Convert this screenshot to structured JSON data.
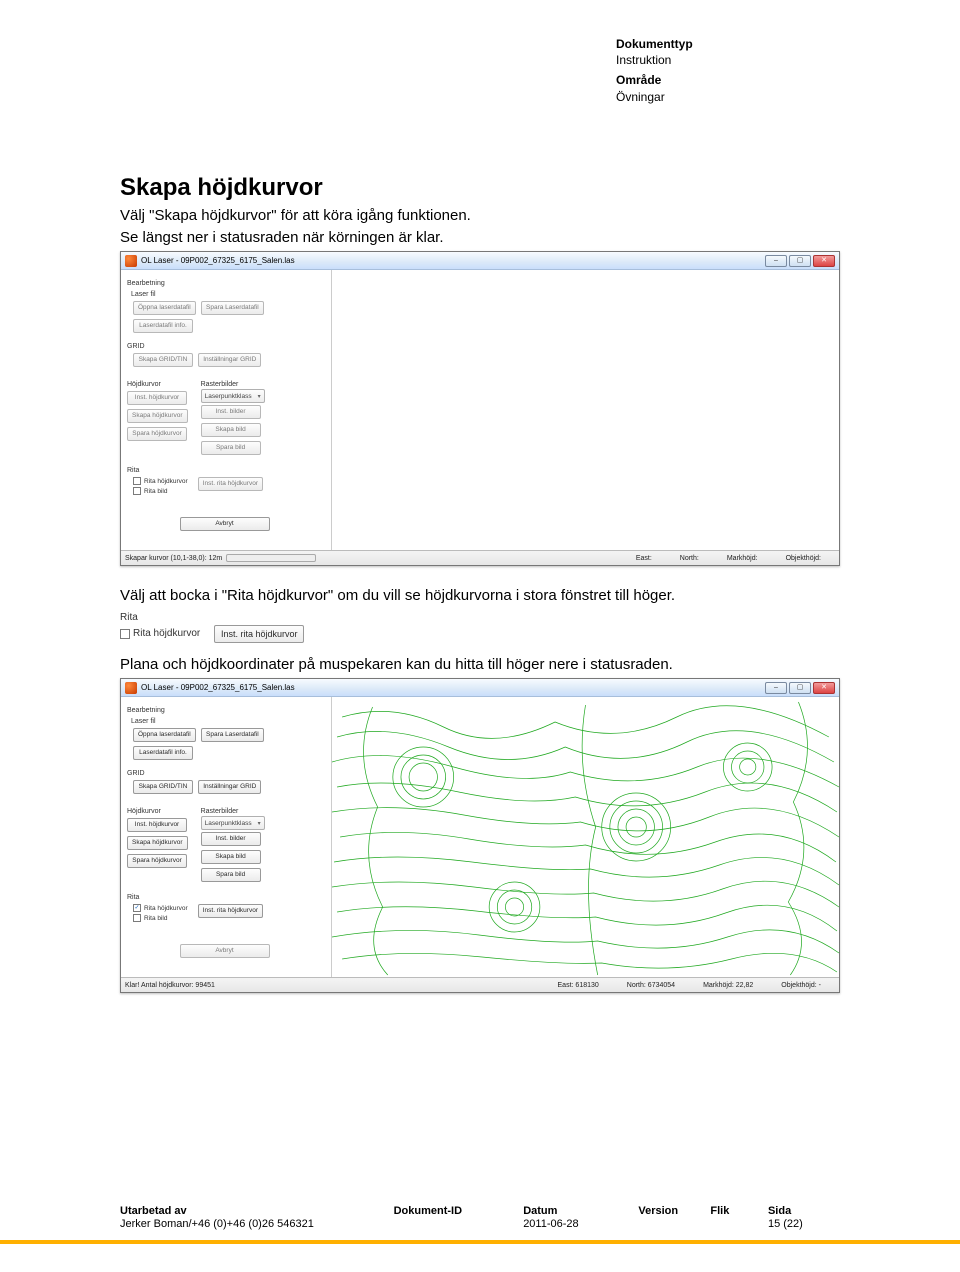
{
  "header": {
    "dokumenttyp_label": "Dokumenttyp",
    "dokumenttyp_value": "Instruktion",
    "omrade_label": "Område",
    "omrade_value": "Övningar"
  },
  "section": {
    "title": "Skapa höjdkurvor",
    "p1": "Välj \"Skapa höjdkurvor\" för att köra igång funktionen.",
    "p2": "Se längst ner i statusraden när körningen är klar.",
    "p3": "Välj att bocka i \"Rita höjdkurvor\" om du vill se höjdkurvorna i stora fönstret till höger.",
    "p4": "Plana och höjdkoordinater på muspekaren kan du hitta till höger nere i statusraden."
  },
  "win": {
    "title": "OL Laser - 09P002_67325_6175_Salen.las",
    "group_bearb": "Bearbetning",
    "group_laserfil": "Laser fil",
    "btn_oppna": "Öppna laserdatafil",
    "btn_spara_laser": "Spara Laserdatafil",
    "btn_laserinfo": "Laserdatafil info.",
    "group_grid": "GRID",
    "btn_skapa_grid": "Skapa GRID/TIN",
    "btn_inst_grid": "Inställningar GRID",
    "group_hojd": "Höjdkurvor",
    "btn_inst_hojd": "Inst. höjdkurvor",
    "btn_skapa_hojd": "Skapa höjdkurvor",
    "btn_spara_hojd": "Spara höjdkurvor",
    "group_raster": "Rasterbilder",
    "sel_laserklass": "Laserpunktklass",
    "btn_inst_bilder": "Inst. bilder",
    "btn_skapa_bild": "Skapa bild",
    "btn_spara_bild": "Spara bild",
    "group_rita": "Rita",
    "chk_rita_hojd": "Rita höjdkurvor",
    "btn_inst_rita": "Inst. rita höjdkurvor",
    "chk_rita_bild": "Rita bild",
    "btn_avbryt": "Avbryt",
    "status1_left": "Skapar kurvor  (10,1-38,0): 12m",
    "status1_right": [
      "East:",
      "North:",
      "Markhöjd:",
      "Objekthöjd:"
    ],
    "status2_left": "Klar! Antal höjdkurvor: 99451",
    "status2_right_labels": [
      "East:",
      "North:",
      "Markhöjd:",
      "Objekthöjd:"
    ],
    "status2_right_values": [
      "618130",
      "6734054",
      "22,82",
      "-"
    ]
  },
  "footer": {
    "h": [
      "Utarbetad av",
      "Dokument-ID",
      "Datum",
      "Version",
      "Flik",
      "Sida"
    ],
    "author": "Jerker Boman/+46 (0)+46 (0)26 546321",
    "datum": "2011-06-28",
    "sida": "15 (22)"
  }
}
